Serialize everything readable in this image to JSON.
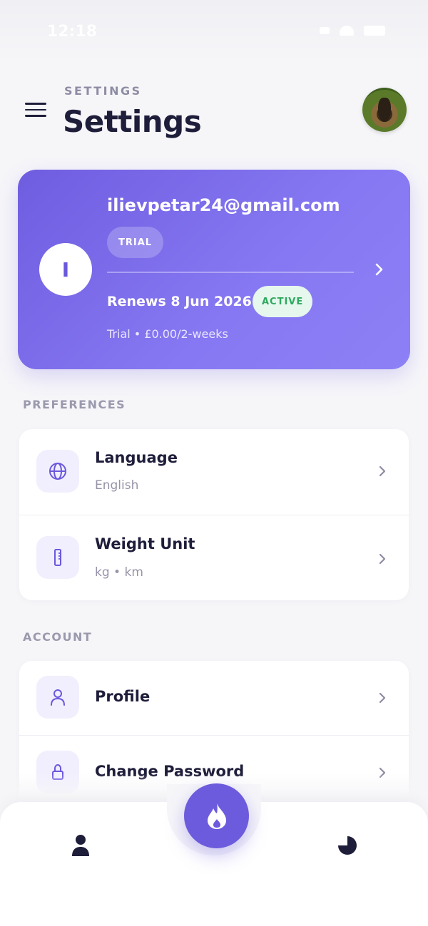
{
  "status_bar": {
    "time": "12:18"
  },
  "header": {
    "eyebrow": "SETTINGS",
    "title": "Settings",
    "menu_icon": "hamburger-menu-icon",
    "avatar_icon": "dog-avatar"
  },
  "subscription": {
    "initial": "I",
    "email": "ilievpetar24@gmail.com",
    "badge": "TRIAL",
    "renews": "Renews 8 Jun 2026",
    "status": "ACTIVE",
    "plan": "Trial • £0.00/2-weeks",
    "accent": "#6f5de0",
    "status_color": "#2eaa5e"
  },
  "preferences": {
    "label": "PREFERENCES",
    "items": [
      {
        "title": "Language",
        "subtitle": "English",
        "icon": "globe-icon"
      },
      {
        "title": "Weight Unit",
        "subtitle": "kg • km",
        "icon": "ruler-icon"
      }
    ]
  },
  "account": {
    "label": "ACCOUNT",
    "items": [
      {
        "title": "Profile",
        "icon": "user-icon"
      },
      {
        "title": "Change Password",
        "icon": "lock-icon"
      }
    ]
  },
  "bottom_nav": {
    "items": [
      "person-icon",
      "flame-icon",
      "pie-chart-icon"
    ],
    "fab_color": "#6c5bdc"
  }
}
